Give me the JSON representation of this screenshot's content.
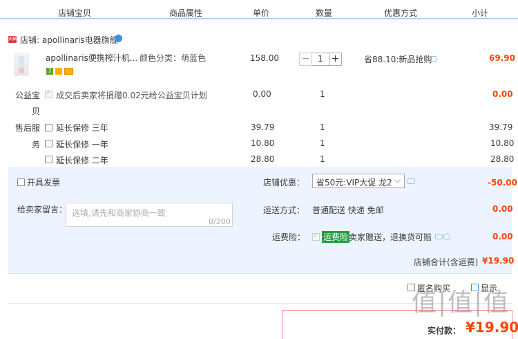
{
  "header": {
    "col_item": "店铺宝贝",
    "col_attr": "商品属性",
    "col_price": "单价",
    "col_qty": "数量",
    "col_promo": "优惠方式",
    "col_subtotal": "小计"
  },
  "shop": {
    "label": "店铺: apollinaris电器旗舰",
    "badge": "天猫"
  },
  "product": {
    "title": "apollinaris便携榨汁机...",
    "attr": "颜色分类：萌蓝色",
    "price": "158.00",
    "qty": "1",
    "minus": "−",
    "plus": "+",
    "promo": "省88.10:新品抢购",
    "subtotal": "69.90",
    "badge_7": "7"
  },
  "charity": {
    "label": "公益宝",
    "label2": "贝",
    "text": "成交后卖家将捐赠0.02元给公益宝贝计划",
    "price": "0.00",
    "qty": "1",
    "subtotal": "0.00"
  },
  "warranty": {
    "label": "售后服",
    "label2": "务",
    "items": [
      {
        "name": "延长保修 三年",
        "price": "39.79",
        "qty": "1",
        "subtotal": "39.79"
      },
      {
        "name": "延长保修 一年",
        "price": "10.80",
        "qty": "1",
        "subtotal": "10.80"
      },
      {
        "name": "延长保修 二年",
        "price": "28.80",
        "qty": "1",
        "subtotal": "28.80"
      }
    ]
  },
  "invoice_label": "开具发票",
  "shop_discount": {
    "label": "店铺优惠：",
    "selected": "省50元:VIP大促 龙2",
    "amount": "-50.00"
  },
  "message": {
    "label": "给卖家留言：",
    "placeholder": "选填,请先和商家协商一致",
    "counter": "0/200"
  },
  "shipping": {
    "label": "运送方式：",
    "value": "普通配送 快递 免邮",
    "amount": "0.00"
  },
  "insurance": {
    "label": "运费险：",
    "tag": "运费险",
    "text": "卖家赠送，退换货可赔",
    "amount": "0.00"
  },
  "total": {
    "label": "店铺合计(含运费)",
    "amount": "¥19.90"
  },
  "footer": {
    "actual_pay_label": "实付款：",
    "actual_pay_amount": "¥19.90",
    "opt1": "匿名购买",
    "opt2": "显示"
  },
  "watermark": "值|值|值"
}
